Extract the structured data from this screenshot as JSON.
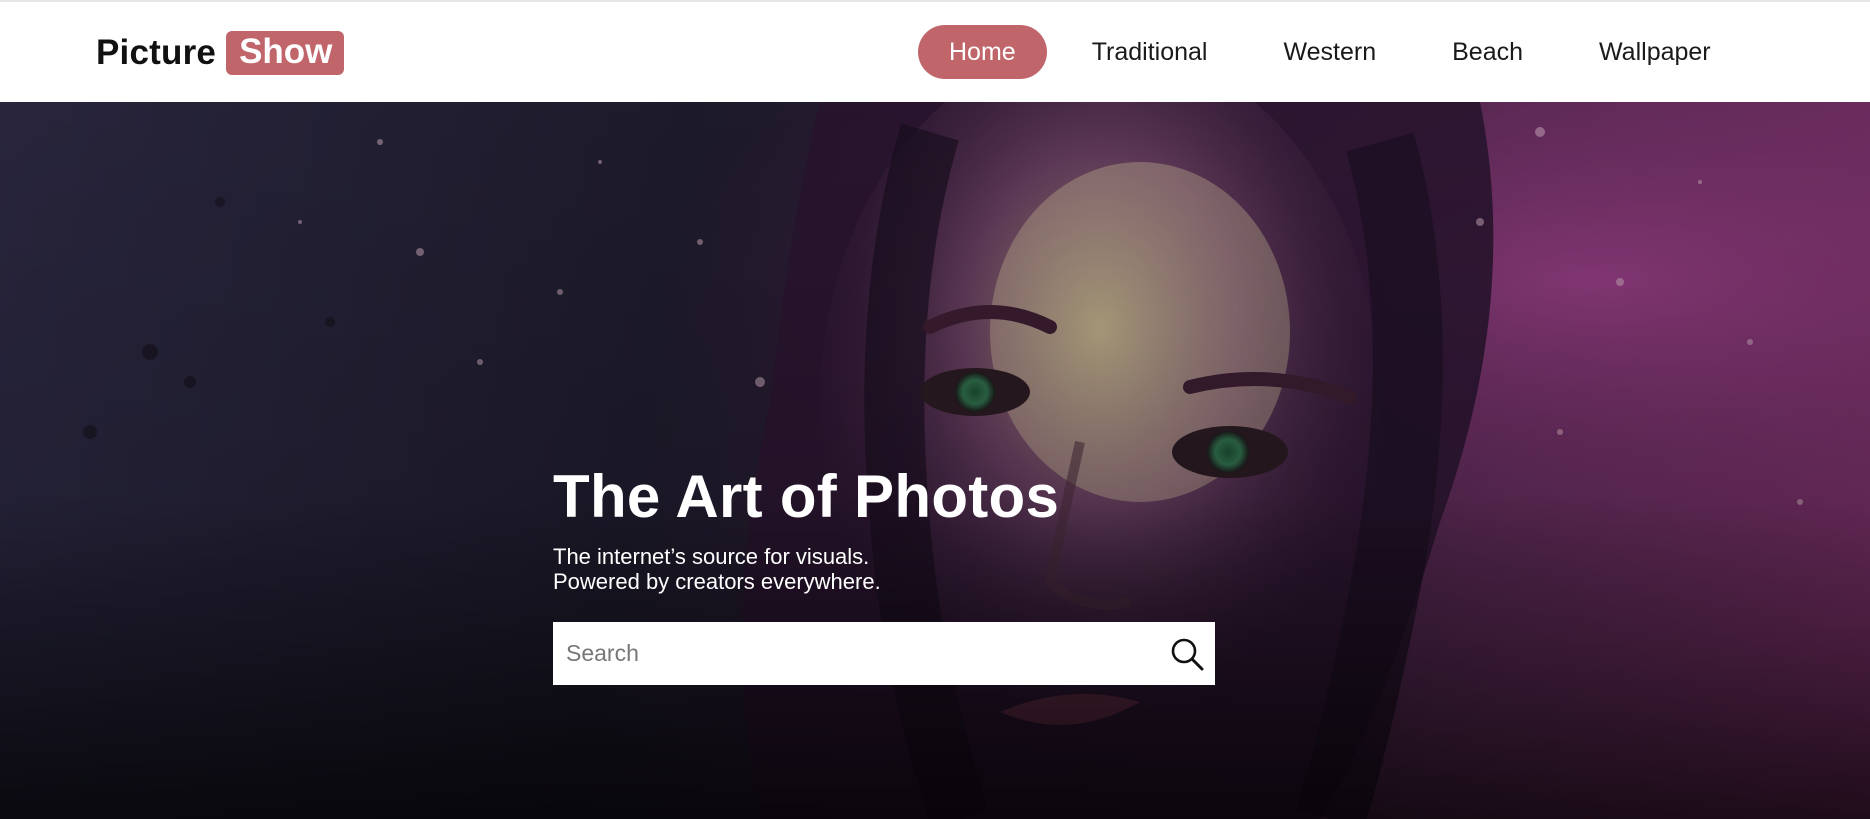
{
  "brand": {
    "name": "Picture",
    "badge": "Show",
    "accent": "#c0666a"
  },
  "nav": {
    "items": [
      {
        "label": "Home",
        "active": true
      },
      {
        "label": "Traditional",
        "active": false
      },
      {
        "label": "Western",
        "active": false
      },
      {
        "label": "Beach",
        "active": false
      },
      {
        "label": "Wallpaper",
        "active": false
      }
    ]
  },
  "hero": {
    "title": "The Art of Photos",
    "subtitle_line1": "The internet’s source for visuals.",
    "subtitle_line2": "Powered by creators everywhere.",
    "background": "portrait painting of a woman with purple tones"
  },
  "search": {
    "placeholder": "Search",
    "value": "",
    "icon": "search-icon"
  }
}
